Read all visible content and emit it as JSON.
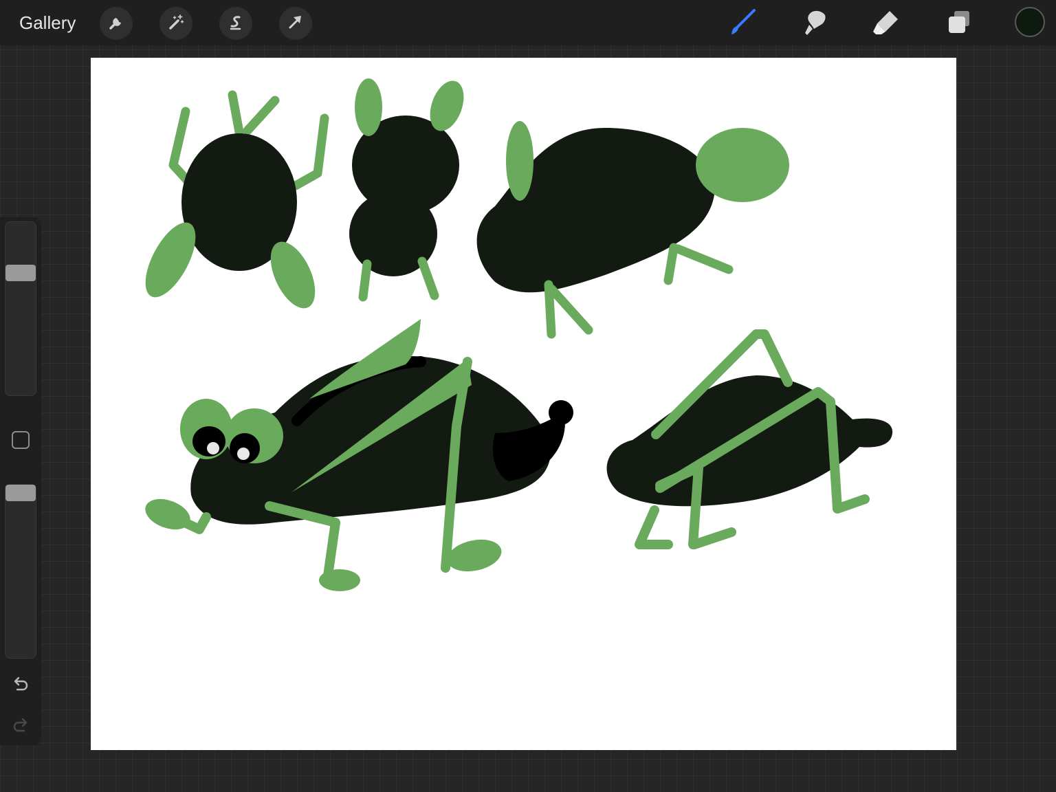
{
  "topbar": {
    "gallery_label": "Gallery",
    "left_tools": [
      {
        "icon": "wrench-icon",
        "name": "actions"
      },
      {
        "icon": "magic-wand-icon",
        "name": "adjustments"
      },
      {
        "icon": "selection-icon",
        "name": "selection"
      },
      {
        "icon": "arrow-cursor-icon",
        "name": "transform"
      }
    ],
    "right_tools": [
      {
        "icon": "brush-icon",
        "name": "brush",
        "active": true
      },
      {
        "icon": "smudge-icon",
        "name": "smudge",
        "active": false
      },
      {
        "icon": "eraser-icon",
        "name": "eraser",
        "active": false
      },
      {
        "icon": "layers-icon",
        "name": "layers",
        "active": false
      }
    ],
    "current_color": "#0e1a10"
  },
  "sidebar": {
    "brush_size_level": 0.27,
    "opacity_level": 0.0,
    "modify_icon": "square-icon",
    "undo_icon": "undo-icon",
    "redo_icon": "redo-icon"
  },
  "colors": {
    "accent_blue": "#3a7bff",
    "ink_dark": "#121a11",
    "ink_black": "#000000",
    "leaf_green": "#6aaa5c",
    "eye_white": "#e8e8e8"
  }
}
